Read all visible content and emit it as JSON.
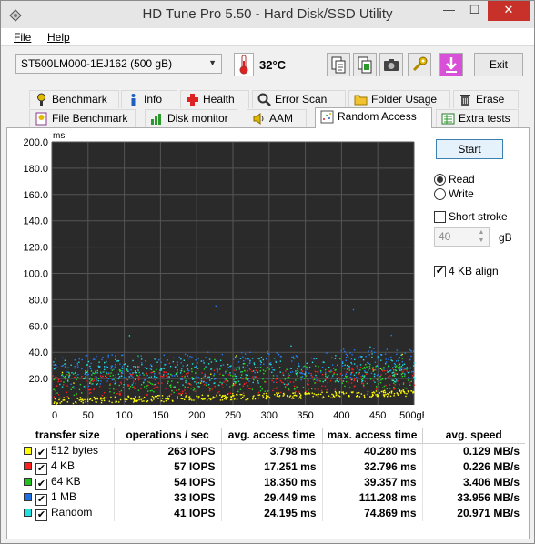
{
  "window": {
    "title": "HD Tune Pro 5.50 - Hard Disk/SSD Utility",
    "controls": {
      "minimize": "—",
      "maximize": "☐",
      "close": "✕"
    }
  },
  "menu": [
    {
      "label": "File"
    },
    {
      "label": "Help"
    }
  ],
  "toolbar": {
    "drive": "ST500LM000-1EJ162 (500 gB)",
    "temperature": "32°C",
    "exit_label": "Exit",
    "icons": [
      "copy-text-icon",
      "copy-info-icon",
      "screenshot-icon",
      "options-icon",
      "save-icon"
    ]
  },
  "tabs_row1": [
    {
      "label": "Benchmark",
      "icon": "benchmark-icon"
    },
    {
      "label": "Info",
      "icon": "info-icon"
    },
    {
      "label": "Health",
      "icon": "health-icon"
    },
    {
      "label": "Error Scan",
      "icon": "error-scan-icon"
    },
    {
      "label": "Folder Usage",
      "icon": "folder-icon"
    },
    {
      "label": "Erase",
      "icon": "erase-icon"
    }
  ],
  "tabs_row2": [
    {
      "label": "File Benchmark",
      "icon": "file-benchmark-icon"
    },
    {
      "label": "Disk monitor",
      "icon": "disk-monitor-icon"
    },
    {
      "label": "AAM",
      "icon": "speaker-icon"
    },
    {
      "label": "Random Access",
      "icon": "random-access-icon",
      "active": true
    },
    {
      "label": "Extra tests",
      "icon": "extra-tests-icon"
    }
  ],
  "controls": {
    "start_label": "Start",
    "read_label": "Read",
    "write_label": "Write",
    "mode": "read",
    "short_stroke_label": "Short stroke",
    "short_stroke_checked": false,
    "stroke_value": "40",
    "stroke_unit": "gB",
    "align_label": "4 KB align",
    "align_checked": true
  },
  "chart_data": {
    "type": "scatter",
    "ylabel": "ms",
    "xlabel": "",
    "y_ticks": [
      "200.0",
      "180.0",
      "160.0",
      "140.0",
      "120.0",
      "100.0",
      "80.0",
      "60.0",
      "40.0",
      "20.0"
    ],
    "x_ticks": [
      "0",
      "50",
      "100",
      "150",
      "200",
      "250",
      "300",
      "350",
      "400",
      "450",
      "500gB"
    ],
    "xlim": [
      0,
      500
    ],
    "ylim": [
      0,
      200
    ],
    "grid": true,
    "background": "#2a2a2a",
    "series": [
      {
        "name": "512 bytes",
        "color": "#ffff00",
        "avg_ms": 3.798,
        "max_ms": 40.28,
        "spread": [
          1,
          6
        ]
      },
      {
        "name": "4 KB",
        "color": "#ff2020",
        "avg_ms": 17.251,
        "max_ms": 32.796,
        "spread": [
          6,
          24
        ]
      },
      {
        "name": "64 KB",
        "color": "#20e020",
        "avg_ms": 18.35,
        "max_ms": 39.357,
        "spread": [
          7,
          26
        ]
      },
      {
        "name": "1 MB",
        "color": "#1e7fff",
        "avg_ms": 29.449,
        "max_ms": 111.208,
        "spread": [
          14,
          38
        ]
      },
      {
        "name": "Random",
        "color": "#20e0e0",
        "avg_ms": 24.195,
        "max_ms": 74.869,
        "spread": [
          12,
          34
        ]
      }
    ]
  },
  "results": {
    "headers": [
      "transfer size",
      "operations / sec",
      "avg. access time",
      "max. access time",
      "avg. speed"
    ],
    "rows": [
      {
        "label": "512 bytes",
        "color": "#ffff00",
        "checked": "✔",
        "ops": "263 IOPS",
        "avg": "3.798 ms",
        "max": "40.280 ms",
        "speed": "0.129 MB/s"
      },
      {
        "label": "4 KB",
        "color": "#ff2020",
        "checked": "✔",
        "ops": "57 IOPS",
        "avg": "17.251 ms",
        "max": "32.796 ms",
        "speed": "0.226 MB/s"
      },
      {
        "label": "64 KB",
        "color": "#20c020",
        "checked": "✔",
        "ops": "54 IOPS",
        "avg": "18.350 ms",
        "max": "39.357 ms",
        "speed": "3.406 MB/s"
      },
      {
        "label": "1 MB",
        "color": "#1e6fdf",
        "checked": "✔",
        "ops": "33 IOPS",
        "avg": "29.449 ms",
        "max": "111.208 ms",
        "speed": "33.956 MB/s"
      },
      {
        "label": "Random",
        "color": "#20e0e0",
        "checked": "✔",
        "ops": "41 IOPS",
        "avg": "24.195 ms",
        "max": "74.869 ms",
        "speed": "20.971 MB/s"
      }
    ]
  }
}
